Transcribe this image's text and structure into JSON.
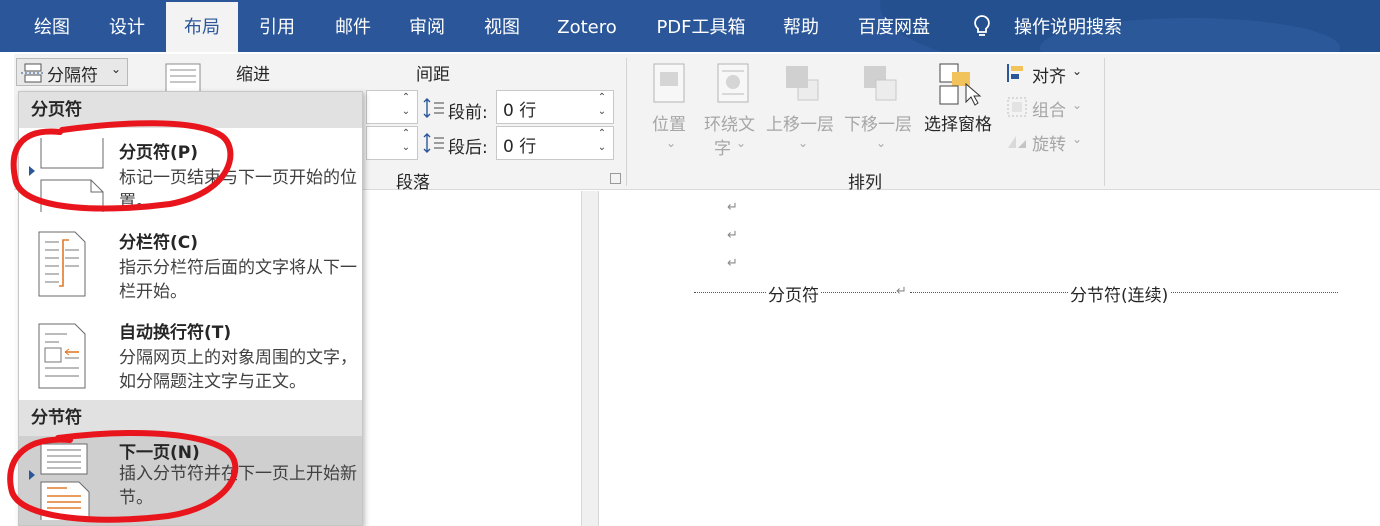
{
  "tabs": [
    {
      "label": "绘图"
    },
    {
      "label": "设计"
    },
    {
      "label": "布局",
      "active": true
    },
    {
      "label": "引用"
    },
    {
      "label": "邮件"
    },
    {
      "label": "审阅"
    },
    {
      "label": "视图"
    },
    {
      "label": "Zotero"
    },
    {
      "label": "PDF工具箱"
    },
    {
      "label": "帮助"
    },
    {
      "label": "百度网盘"
    }
  ],
  "search": {
    "label": "操作说明搜索",
    "icon": "lightbulb-icon"
  },
  "ribbon": {
    "breaks_button": "分隔符",
    "indent_label": "缩进",
    "spacing_label": "间距",
    "before_label": "段前:",
    "before_value": "0 行",
    "after_label": "段后:",
    "after_value": "0 行",
    "paragraph_group": "段落",
    "arrange_group": "排列",
    "position": "位置",
    "wrap_text_1": "环绕文",
    "wrap_text_2": "字",
    "bring_forward": "上移一层",
    "send_backward": "下移一层",
    "selection_pane": "选择窗格",
    "align": "对齐",
    "group": "组合",
    "rotate": "旋转"
  },
  "menu": {
    "page_breaks_header": "分页符",
    "section_breaks_header": "分节符",
    "items": [
      {
        "title": "分页符(P)",
        "desc": "标记一页结束与下一页开始的位置。",
        "icon": "page-break-icon"
      },
      {
        "title": "分栏符(C)",
        "desc": "指示分栏符后面的文字将从下一栏开始。",
        "icon": "column-break-icon"
      },
      {
        "title": "自动换行符(T)",
        "desc": "分隔网页上的对象周围的文字，如分隔题注文字与正文。",
        "icon": "text-wrapping-break-icon"
      },
      {
        "title": "下一页(N)",
        "desc": "插入分节符并在下一页上开始新节。",
        "icon": "next-page-section-icon",
        "highlighted": true
      }
    ]
  },
  "document": {
    "paragraph_mark": "↵",
    "page_break_label": "分页符",
    "section_break_label": "分节符(连续)"
  },
  "colors": {
    "accent": "#2b579a",
    "annotation": "#e8161c"
  }
}
